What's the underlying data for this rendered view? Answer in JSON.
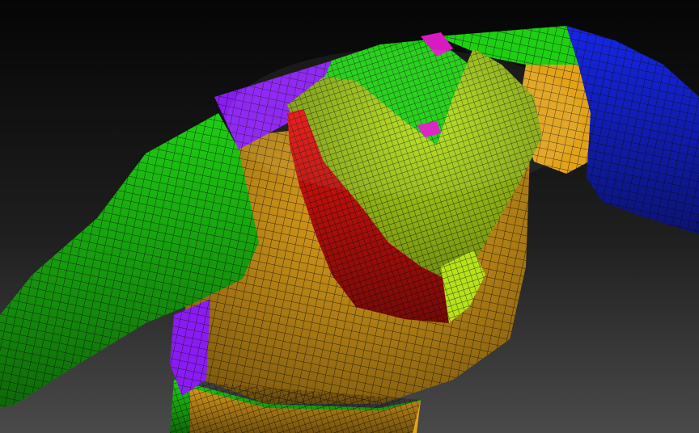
{
  "viewport": {
    "background_top": "#050505",
    "background_bottom": "#4a4a4a",
    "wire_color": "#0c0c0c"
  },
  "polygroup_colors": {
    "green": "#1ecf12",
    "blue": "#1626e6",
    "purple": "#8a1cf2",
    "orange": "#e2a21a",
    "yellow_green": "#b6e21a",
    "red": "#e8140e",
    "magenta": "#d81ac2"
  }
}
